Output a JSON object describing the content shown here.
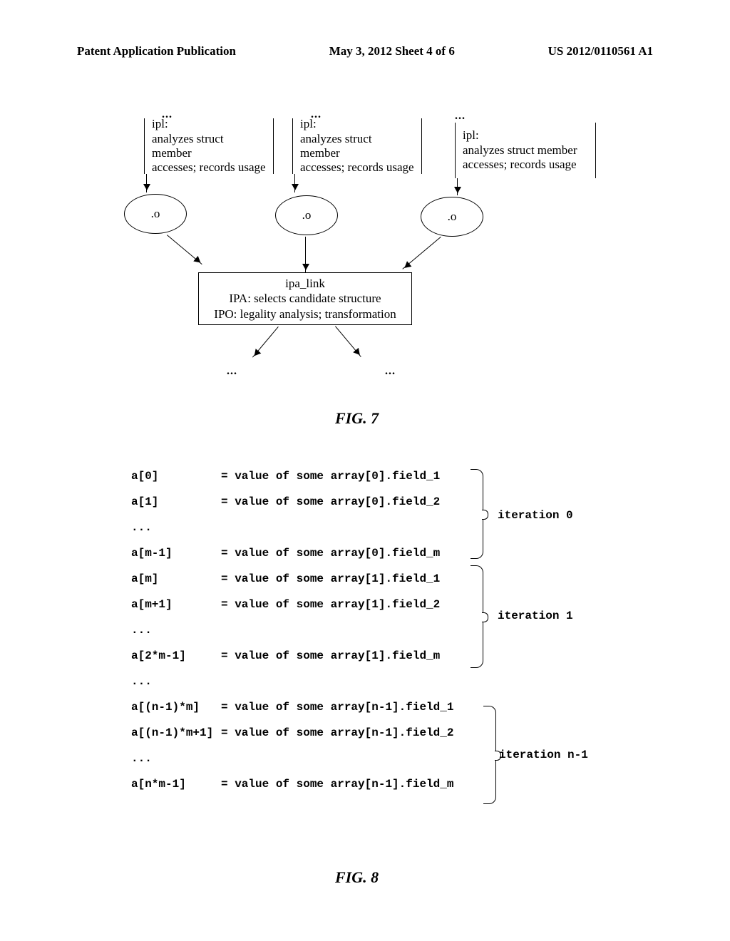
{
  "header": {
    "left": "Patent Application Publication",
    "mid": "May 3, 2012  Sheet 4 of 6",
    "right": "US 2012/0110561 A1"
  },
  "fig7": {
    "topdots": "...",
    "ipl": {
      "line1": "ipl:",
      "line2": "analyzes struct member",
      "line3": "accesses; records usage"
    },
    "ellipse": ".o",
    "ipa": {
      "line1": "ipa_link",
      "line2": "IPA: selects candidate structure",
      "line3": "IPO: legality analysis; transformation"
    },
    "outdots": "...",
    "caption": "FIG. 7"
  },
  "fig8": {
    "rows": [
      {
        "lhs": "a[0]",
        "rhs": "= value of some array[0].field_1"
      },
      {
        "lhs": "a[1]",
        "rhs": "= value of some array[0].field_2"
      },
      {
        "lhs": "...",
        "rhs": ""
      },
      {
        "lhs": "a[m-1]",
        "rhs": "= value of some array[0].field_m"
      },
      {
        "lhs": "a[m]",
        "rhs": "= value of some array[1].field_1"
      },
      {
        "lhs": "a[m+1]",
        "rhs": "= value of some array[1].field_2"
      },
      {
        "lhs": "...",
        "rhs": ""
      },
      {
        "lhs": "a[2*m-1]",
        "rhs": "= value of some array[1].field_m"
      },
      {
        "lhs": "...",
        "rhs": ""
      },
      {
        "lhs": "a[(n-1)*m]",
        "rhs": "= value of some array[n-1].field_1"
      },
      {
        "lhs": "a[(n-1)*m+1]",
        "rhs": "= value of some array[n-1].field_2"
      },
      {
        "lhs": "...",
        "rhs": ""
      },
      {
        "lhs": "a[n*m-1]",
        "rhs": "= value of some array[n-1].field_m"
      }
    ],
    "braces": [
      {
        "label": "iteration 0"
      },
      {
        "label": "iteration 1"
      },
      {
        "label": "iteration n-1"
      }
    ],
    "caption": "FIG. 8"
  }
}
